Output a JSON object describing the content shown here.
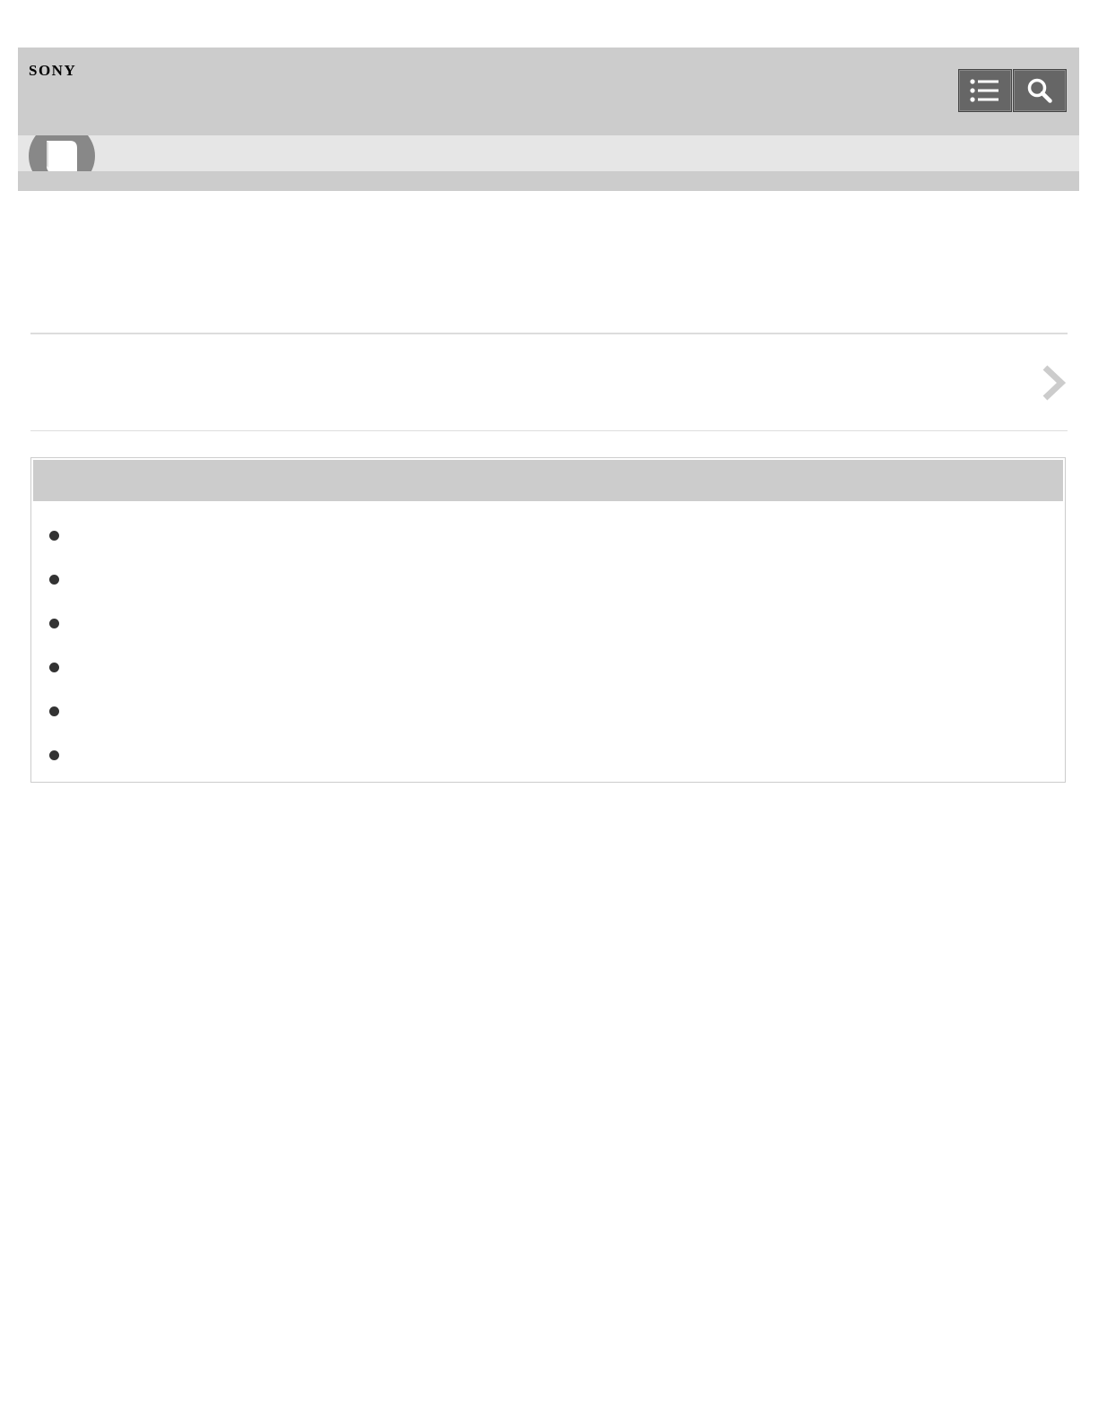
{
  "header": {
    "brand": "SONY",
    "toc_icon": "list-icon",
    "search_icon": "search-icon"
  },
  "category_icon": "book-icon",
  "next_link": {
    "icon": "chevron-right-icon"
  },
  "info_box": {
    "items": [
      "",
      "",
      "",
      "",
      "",
      ""
    ]
  },
  "colors": {
    "header_bg": "#cccccc",
    "subband_bg": "#e6e6e6",
    "button_bg": "#666666",
    "icon_circle": "#888888",
    "chevron": "#cccccc",
    "bullet": "#333333"
  }
}
